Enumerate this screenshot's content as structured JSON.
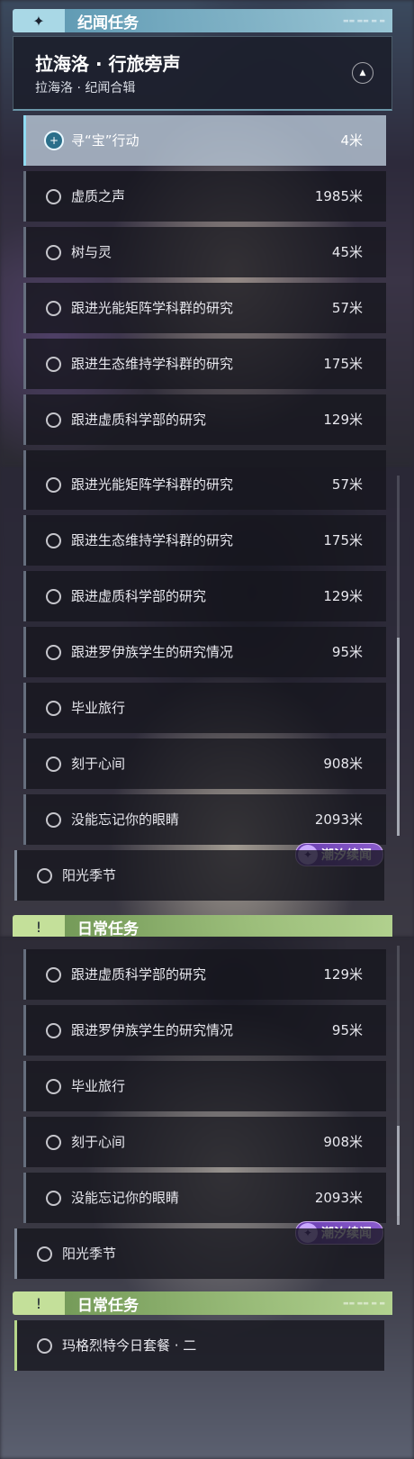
{
  "chronicle_header": {
    "title": "纪闻任务",
    "badge_icon": "sparkle-icon"
  },
  "region": {
    "title": "拉海洛 · 行旅旁声",
    "subtitle": "拉海洛 · 纪闻合辑",
    "collapse_icon": "collapse-icon"
  },
  "quests": [
    {
      "name": "寻“宝”行动",
      "distance": "4米"
    },
    {
      "name": "虚质之声",
      "distance": "1985米"
    },
    {
      "name": "树与灵",
      "distance": "45米"
    },
    {
      "name": "跟进光能矩阵学科群的研究",
      "distance": "57米"
    },
    {
      "name": "跟进生态维持学科群的研究",
      "distance": "175米"
    },
    {
      "name": "跟进虚质科学部的研究",
      "distance": "129米"
    },
    {
      "name": "跟进罗伊族学生的研究情况",
      "distance": "95米"
    },
    {
      "name": "毕业旅行",
      "distance": ""
    },
    {
      "name": "刻于心间",
      "distance": "908米"
    },
    {
      "name": "没能忘记你的眼睛",
      "distance": "2093米"
    }
  ],
  "tidal_tag": {
    "label": "潮汐续闻",
    "icon": "tide-icon"
  },
  "tidal_quest": {
    "name": "阳光季节"
  },
  "daily_header": {
    "title": "日常任务",
    "badge_icon": "exclamation-icon"
  },
  "daily_quest": {
    "name": "玛格烈特今日套餐 · 二"
  },
  "colors": {
    "chronicle_accent": "#a9d8e6",
    "daily_accent": "#c4e09a",
    "tidal_accent": "#7b4bc0"
  }
}
